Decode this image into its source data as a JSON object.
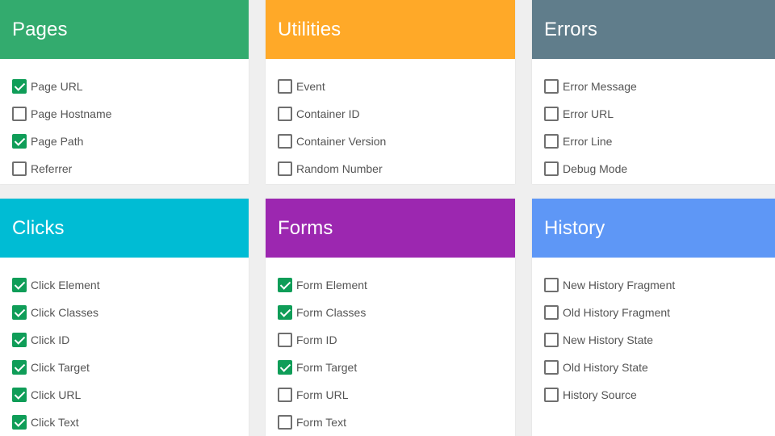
{
  "colors": {
    "pages": "#33ab6e",
    "utilities": "#ffa928",
    "errors": "#607d8b",
    "clicks": "#00bcd4",
    "forms": "#9c27b0",
    "history": "#5e97f6",
    "checked": "#0f9d58"
  },
  "cards": {
    "pages": {
      "title": "Pages",
      "items": [
        {
          "label": "Page URL",
          "checked": true
        },
        {
          "label": "Page Hostname",
          "checked": false
        },
        {
          "label": "Page Path",
          "checked": true
        },
        {
          "label": "Referrer",
          "checked": false
        }
      ]
    },
    "utilities": {
      "title": "Utilities",
      "items": [
        {
          "label": "Event",
          "checked": false
        },
        {
          "label": "Container ID",
          "checked": false
        },
        {
          "label": "Container Version",
          "checked": false
        },
        {
          "label": "Random Number",
          "checked": false
        }
      ]
    },
    "errors": {
      "title": "Errors",
      "items": [
        {
          "label": "Error Message",
          "checked": false
        },
        {
          "label": "Error URL",
          "checked": false
        },
        {
          "label": "Error Line",
          "checked": false
        },
        {
          "label": "Debug Mode",
          "checked": false
        }
      ]
    },
    "clicks": {
      "title": "Clicks",
      "items": [
        {
          "label": "Click Element",
          "checked": true
        },
        {
          "label": "Click Classes",
          "checked": true
        },
        {
          "label": "Click ID",
          "checked": true
        },
        {
          "label": "Click Target",
          "checked": true
        },
        {
          "label": "Click URL",
          "checked": true
        },
        {
          "label": "Click Text",
          "checked": true
        }
      ]
    },
    "forms": {
      "title": "Forms",
      "items": [
        {
          "label": "Form Element",
          "checked": true
        },
        {
          "label": "Form Classes",
          "checked": true
        },
        {
          "label": "Form ID",
          "checked": false
        },
        {
          "label": "Form Target",
          "checked": true
        },
        {
          "label": "Form URL",
          "checked": false
        },
        {
          "label": "Form Text",
          "checked": false
        }
      ]
    },
    "history": {
      "title": "History",
      "items": [
        {
          "label": "New History Fragment",
          "checked": false
        },
        {
          "label": "Old History Fragment",
          "checked": false
        },
        {
          "label": "New History State",
          "checked": false
        },
        {
          "label": "Old History State",
          "checked": false
        },
        {
          "label": "History Source",
          "checked": false
        }
      ]
    }
  }
}
